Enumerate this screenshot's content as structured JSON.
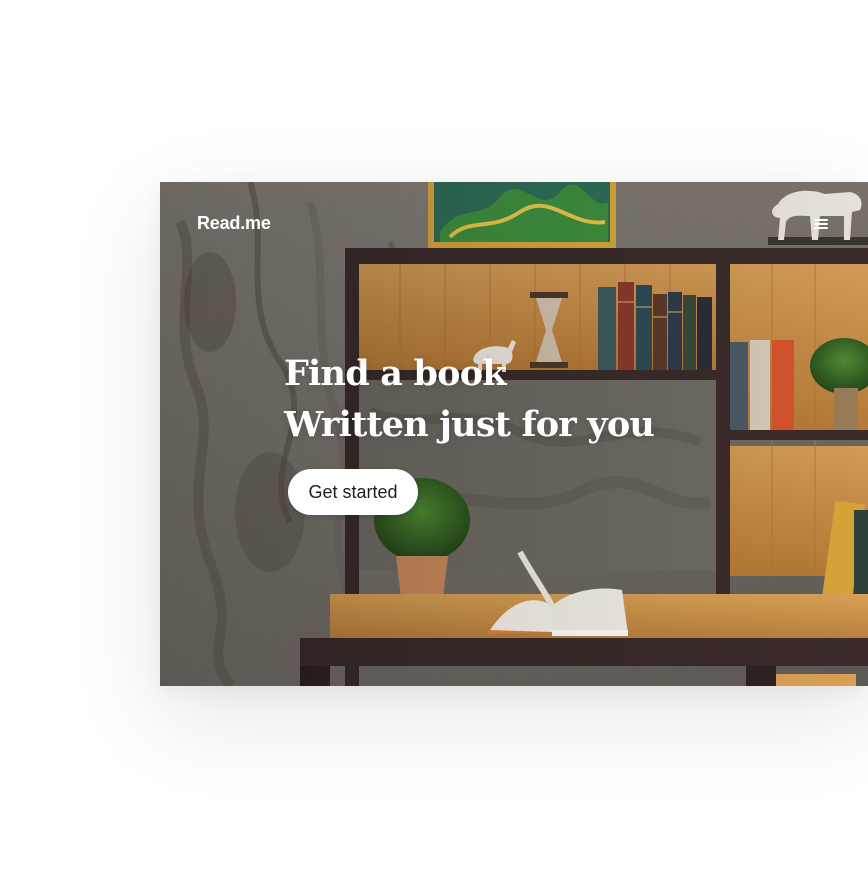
{
  "header": {
    "brand": "Read.me",
    "menu_icon": "hamburger-menu-icon"
  },
  "hero": {
    "headline_line1": "Find a book",
    "headline_line2": "Written just for you",
    "cta_label": "Get started",
    "background": "bookshelf-desk-photo"
  },
  "colors": {
    "text_on_image": "#ffffff",
    "button_bg": "#ffffff",
    "button_text": "#1d1d1d"
  }
}
